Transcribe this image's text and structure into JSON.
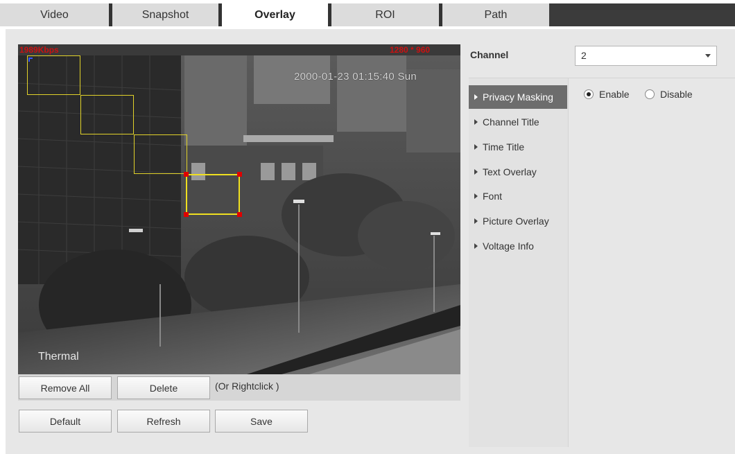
{
  "tabs": [
    {
      "label": "Video"
    },
    {
      "label": "Snapshot"
    },
    {
      "label": "Overlay"
    },
    {
      "label": "ROI"
    },
    {
      "label": "Path"
    }
  ],
  "video": {
    "bitrate": "1989Kbps",
    "resolution": "1280 * 960",
    "timestamp": "2000-01-23 01:15:40 Sun",
    "thermal_label": "Thermal"
  },
  "actions": {
    "remove_all": "Remove All",
    "delete": "Delete",
    "rightclick_hint": "(Or Rightclick )",
    "default": "Default",
    "refresh": "Refresh",
    "save": "Save"
  },
  "channel": {
    "label": "Channel",
    "value": "2"
  },
  "menu": [
    {
      "label": "Privacy Masking",
      "active": true
    },
    {
      "label": "Channel Title"
    },
    {
      "label": "Time Title"
    },
    {
      "label": "Text Overlay"
    },
    {
      "label": "Font"
    },
    {
      "label": "Picture Overlay"
    },
    {
      "label": "Voltage Info"
    }
  ],
  "privacy_masking": {
    "enable_label": "Enable",
    "disable_label": "Disable",
    "selected": "Enable"
  },
  "colors": {
    "mask_border": "#e2d32a",
    "handle": "#e00000",
    "osd_red": "#cc1111",
    "active_menu": "#6d6d6d"
  }
}
